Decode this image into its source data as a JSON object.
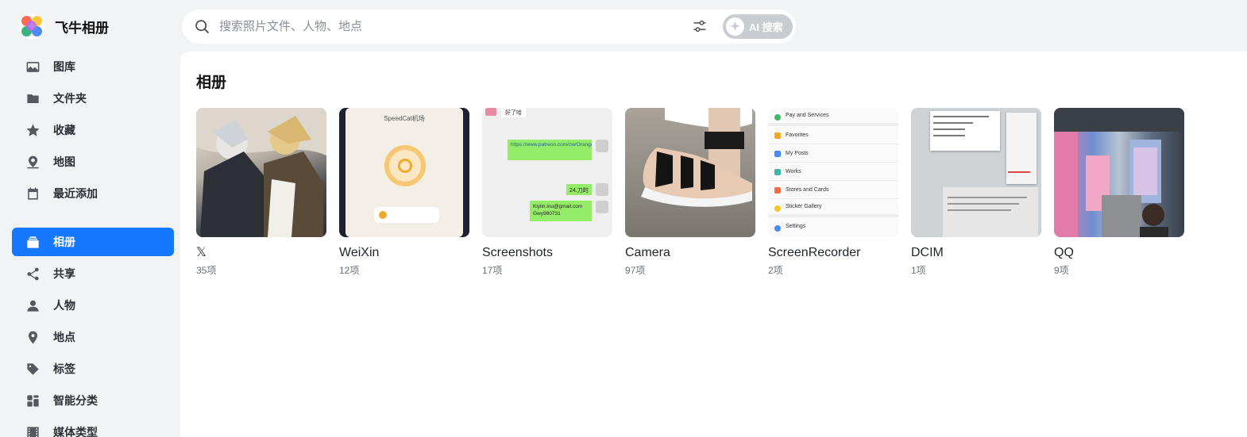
{
  "app": {
    "name": "飞牛相册"
  },
  "search": {
    "placeholder": "搜索照片文件、人物、地点",
    "ai_label": "AI 搜索"
  },
  "sidebar": {
    "group1": [
      {
        "label": "图库",
        "icon": "image-icon"
      },
      {
        "label": "文件夹",
        "icon": "folder-icon"
      },
      {
        "label": "收藏",
        "icon": "star-icon"
      },
      {
        "label": "地图",
        "icon": "map-pin-icon"
      },
      {
        "label": "最近添加",
        "icon": "calendar-icon"
      }
    ],
    "group2": [
      {
        "label": "相册",
        "icon": "album-icon",
        "active": true
      },
      {
        "label": "共享",
        "icon": "share-icon"
      },
      {
        "label": "人物",
        "icon": "person-icon"
      },
      {
        "label": "地点",
        "icon": "location-icon"
      },
      {
        "label": "标签",
        "icon": "tag-icon"
      },
      {
        "label": "智能分类",
        "icon": "grid-icon"
      },
      {
        "label": "媒体类型",
        "icon": "film-icon"
      }
    ]
  },
  "main": {
    "title": "相册",
    "albums": [
      {
        "name": "𝕏",
        "count": "35项",
        "thumb": "anime-illustration"
      },
      {
        "name": "WeiXin",
        "count": "12项",
        "thumb": "phone-screen"
      },
      {
        "name": "Screenshots",
        "count": "17项",
        "thumb": "chat-screenshot"
      },
      {
        "name": "Camera",
        "count": "97项",
        "thumb": "sandal-photo"
      },
      {
        "name": "ScreenRecorder",
        "count": "2项",
        "thumb": "settings-list"
      },
      {
        "name": "DCIM",
        "count": "1项",
        "thumb": "menu-screenshot"
      },
      {
        "name": "QQ",
        "count": "9项",
        "thumb": "mall-photo"
      }
    ]
  },
  "thumbs": {
    "weixin_title": "SpeedCat机场",
    "chat": {
      "top": "好了哈",
      "link": "https://www.patreon.com/cw/OrangeIceCreamAI",
      "amount": "24.刀的",
      "email": "Kiylin.inu@gmail.com Gwy980731"
    },
    "rec_items": [
      "Pay and Services",
      "Favorites",
      "My Posts",
      "Works",
      "Stores and Cards",
      "Sticker Gallery",
      "Settings"
    ]
  },
  "colors": {
    "accent": "#1677ff",
    "sidebar_bg": "#f2f3f5",
    "main_bg": "#ffffff"
  }
}
